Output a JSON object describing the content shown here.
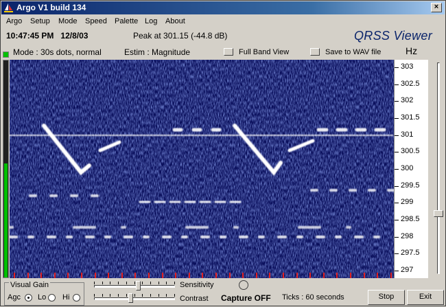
{
  "window": {
    "title": "Argo V1 build 134",
    "close_label": "×"
  },
  "menu": [
    "Argo",
    "Setup",
    "Mode",
    "Speed",
    "Palette",
    "Log",
    "About"
  ],
  "status": {
    "time": "10:47:45 PM",
    "date": "12/8/03",
    "peak": "Peak at  301.15 (-44.8 dB)",
    "brand": "QRSS Viewer",
    "mode": "Mode : 30s dots, normal",
    "estim": "Estim : Magnitude",
    "full_band_label": "Full Band View",
    "save_wav_label": "Save to WAV file",
    "hz_label": "Hz"
  },
  "freq_scale": {
    "ticks": [
      "303",
      "302.5",
      "302",
      "301.5",
      "301",
      "300.5",
      "300",
      "299.5",
      "299",
      "298.5",
      "298",
      "297.5",
      "297"
    ],
    "max": 303.2,
    "min": 296.8
  },
  "controls": {
    "visual_gain_label": "Visual Gain",
    "agc_label": "Agc",
    "lo_label": "Lo",
    "hi_label": "Hi",
    "selected_gain": "Agc",
    "sensitivity_label": "Sensitivity",
    "contrast_label": "Contrast",
    "capture_label": "Capture OFF",
    "ticks_text": "Ticks  : 60 seconds",
    "stop_label": "Stop",
    "exit_label": "Exit",
    "sensitivity_level": 0.55,
    "contrast_level": 0.45,
    "freq_slider_level": 0.28
  },
  "colors": {
    "background": "#0a0f5c",
    "signal": "#ffffff",
    "accent": "#0a246a"
  }
}
